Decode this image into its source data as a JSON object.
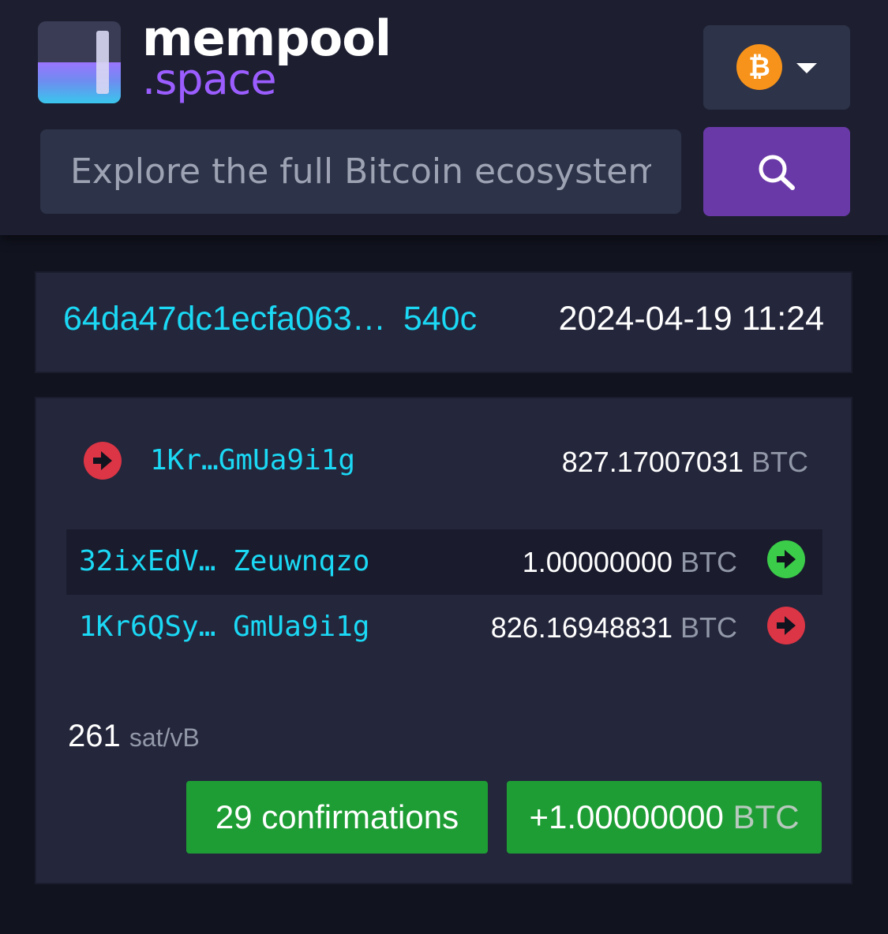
{
  "header": {
    "logo_text_main": "mempool",
    "logo_text_sub": ".space",
    "network_icon": "bitcoin-icon",
    "network_symbol": "₿",
    "search_placeholder": "Explore the full Bitcoin ecosystem"
  },
  "transaction": {
    "txid_start": "64da47dc1ecfa063…",
    "txid_end": "540c",
    "timestamp": "2024-04-19 11:24"
  },
  "inputs": [
    {
      "address": "1Kr…GmUa9i1g",
      "amount": "827.17007031",
      "unit": "BTC"
    }
  ],
  "outputs": [
    {
      "address_start": "32ixEdV…",
      "address_end": "Zeuwnqzo",
      "amount": "1.00000000",
      "unit": "BTC",
      "status": "unspent"
    },
    {
      "address_start": "1Kr6QSy…",
      "address_end": "GmUa9i1g",
      "amount": "826.16948831",
      "unit": "BTC",
      "status": "spent"
    }
  ],
  "fee": {
    "rate": "261",
    "unit": "sat/vB"
  },
  "badges": {
    "confirmations": "29 confirmations",
    "net_amount": "+1.00000000",
    "net_unit": "BTC"
  },
  "colors": {
    "accent_purple": "#6a39a8",
    "link_cyan": "#1bd8f4",
    "success_green": "#1f9d35",
    "spent_red": "#dc3545",
    "unspent_green": "#3bcc49",
    "bitcoin_orange": "#f7931a"
  }
}
